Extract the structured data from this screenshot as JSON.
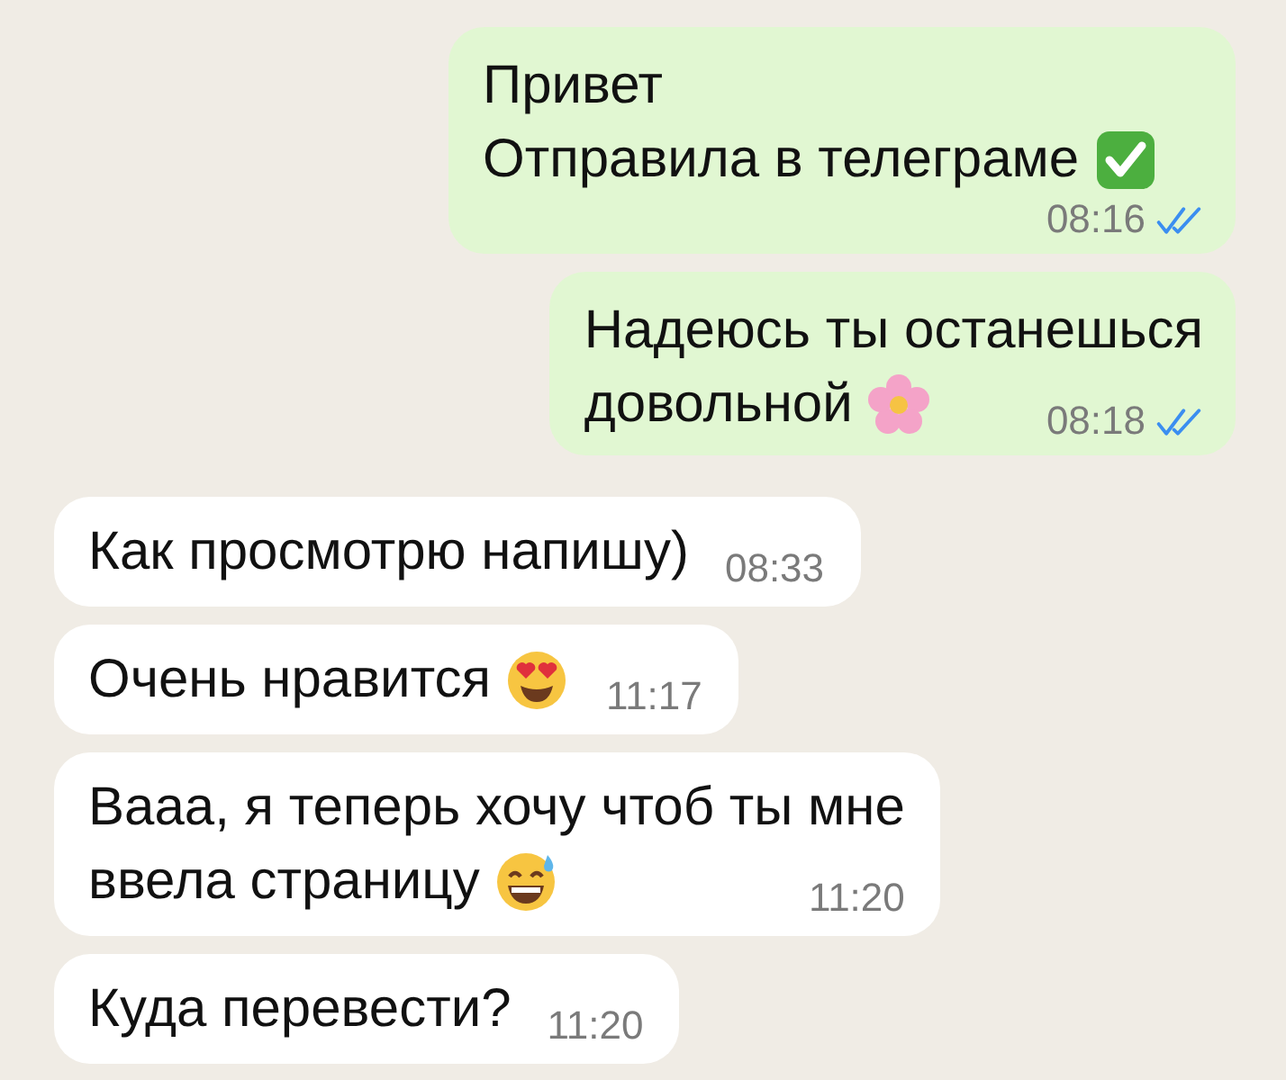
{
  "messages": [
    {
      "kind": "outgoing",
      "lines": [
        "Привет",
        "Отправила в телеграме"
      ],
      "emoji": {
        "kind": "check"
      },
      "time": "08:16",
      "read": true
    },
    {
      "kind": "outgoing",
      "lines": [
        "Надеюсь ты останешься",
        "довольной"
      ],
      "emoji": {
        "kind": "flower"
      },
      "time": "08:18",
      "read": true
    },
    {
      "kind": "incoming",
      "lines": [
        "Как просмотрю напишу)"
      ],
      "time": "08:33"
    },
    {
      "kind": "incoming",
      "lines": [
        "Очень нравится"
      ],
      "emoji": {
        "kind": "heart-eyes"
      },
      "time": "11:17"
    },
    {
      "kind": "incoming",
      "lines": [
        "Вааа, я теперь хочу чтоб ты мне",
        "ввела страницу"
      ],
      "emoji": {
        "kind": "sweat-smile"
      },
      "time": "11:20"
    },
    {
      "kind": "incoming",
      "lines": [
        "Куда перевести?"
      ],
      "time": "11:20"
    }
  ]
}
